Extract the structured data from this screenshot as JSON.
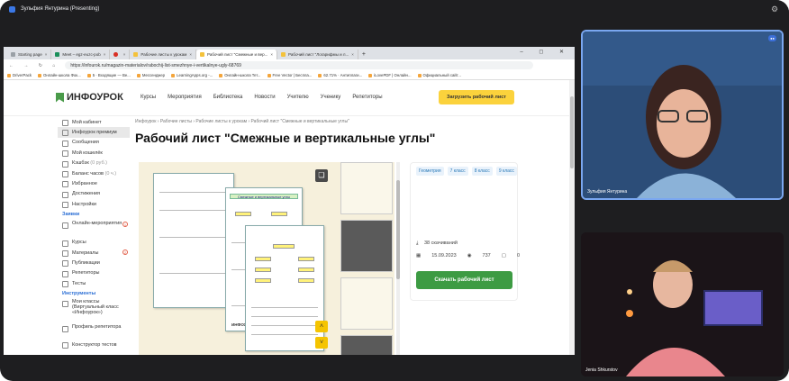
{
  "meeting": {
    "title": "Зульфия Янтурина (Presenting)"
  },
  "browser": {
    "tabs": [
      {
        "label": "Starting page",
        "color": "#9aa0a6"
      },
      {
        "label": "Meet – egz-euzc-pob",
        "color": "#1a8f5a"
      },
      {
        "label": "",
        "color": "#d93025"
      },
      {
        "label": "Рабочие листы к урокам",
        "color": "#f4c23b"
      },
      {
        "label": "Рабочий лист \"Смежные и вер...",
        "color": "#f4c23b",
        "active": true
      },
      {
        "label": "Рабочий лист \"Логарифмы и л...",
        "color": "#f4c23b"
      }
    ],
    "url": "https://infourok.ru/magazin-materialov/rabochij-list-smezhnye-i-vertikalnye-ugly-68769",
    "bookmarks": [
      "DriverPack",
      "Онлайн-школа Фок...",
      "5 · Входящие — Ве...",
      "Мессенджер",
      "LearningApps.org -...",
      "Онлайн-школа Тет...",
      "Free Vector | Бесплa...",
      "62.71% · Антиплаги...",
      "iLovePDF | Онлайн...",
      "Официальный сайт..."
    ]
  },
  "site": {
    "logo": "ИНФОУРОК",
    "nav": [
      "Курсы",
      "Мероприятия",
      "Библиотека",
      "Новости",
      "Учителю",
      "Ученику",
      "Репетиторы"
    ],
    "upload_button": "Загрузить рабочий лист",
    "sidebar": {
      "items_top": [
        "Мой кабинет",
        "Инфоурок премиум",
        "Сообщения",
        "Мой кошелёк",
        "Кэшбэк",
        "Баланс часов",
        "Избранное",
        "Достижения",
        "Настройки"
      ],
      "cashback_hint": "(0 руб.)",
      "hours_hint": "(0 ч.)",
      "section_applications": "Заявки",
      "items_applications": [
        "Онлайн-мероприятия",
        "Курсы",
        "Материалы",
        "Публикации",
        "Репетиторы",
        "Тесты"
      ],
      "count_events": "1",
      "count_materials": "2",
      "section_tools": "Инструменты",
      "items_tools": [
        "Мои классы (Виртуальный класс «Инфоурок»)",
        "Профиль репетитора",
        "Конструктор тестов"
      ]
    },
    "breadcrumb": "Инфоурок › Рабочие листы › Рабочие листы к урокам › Рабочий лист \"Смежные и вертикальные углы\"",
    "page_title": "Рабочий лист \"Смежные и вертикальные углы\"",
    "preview_sheet_title": "Смежные и вертикальные углы",
    "preview_sheet_brand": "ИНФОУРОК",
    "tags": [
      "Геометрия",
      "7 класс",
      "8 класс",
      "9 класс"
    ],
    "downloads": "38 скачиваний",
    "date": "15.09.2023",
    "views": "737",
    "comments": "0",
    "download_button": "Скачать рабочий лист"
  },
  "participants": [
    {
      "name": "Зульфия Янтурина"
    },
    {
      "name": "Jenia Shkurstov"
    }
  ]
}
